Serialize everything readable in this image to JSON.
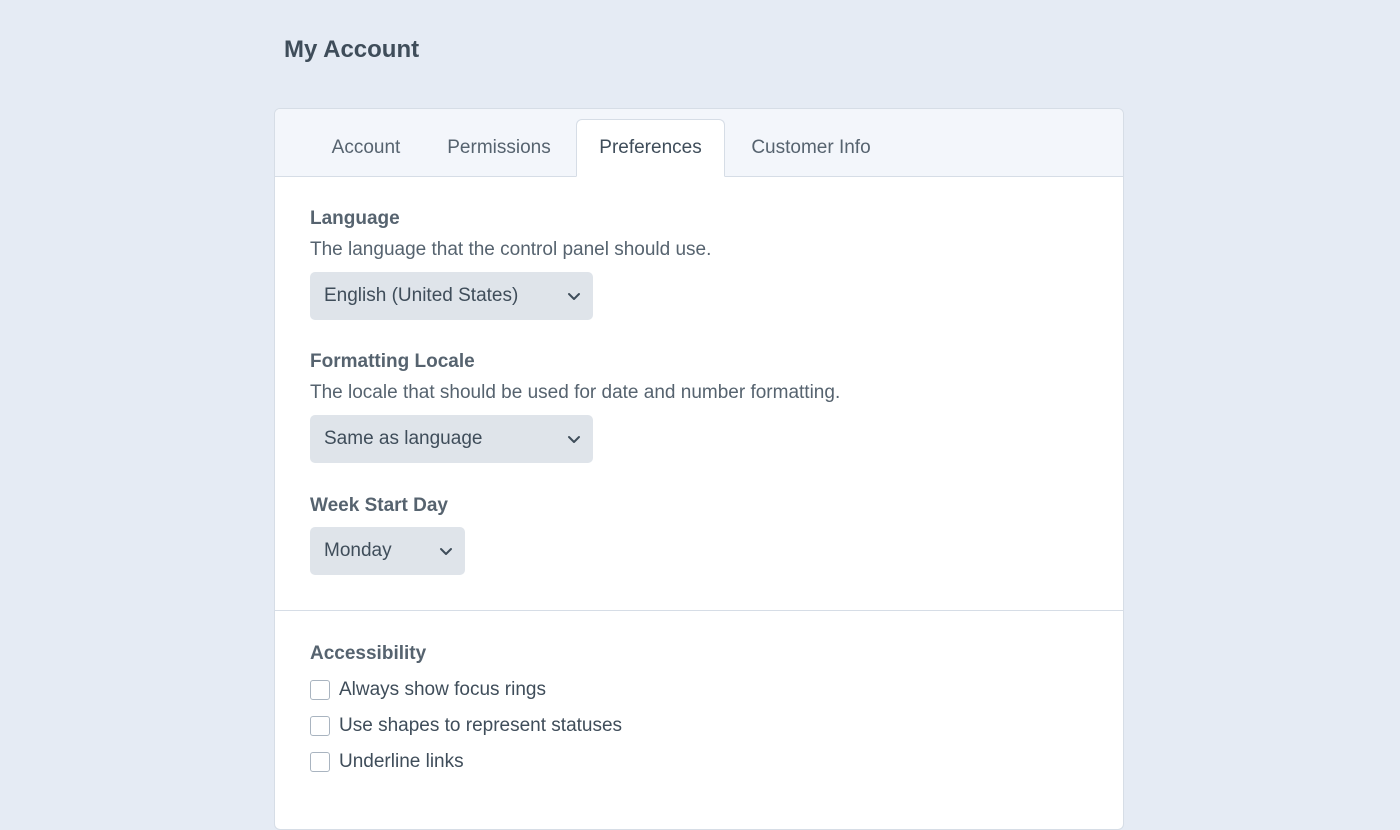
{
  "page": {
    "title": "My Account"
  },
  "tabs": [
    {
      "label": "Account"
    },
    {
      "label": "Permissions"
    },
    {
      "label": "Preferences"
    },
    {
      "label": "Customer Info"
    }
  ],
  "active_tab": "Preferences",
  "fields": {
    "language": {
      "label": "Language",
      "instructions": "The language that the control panel should use.",
      "value": "English (United States)"
    },
    "locale": {
      "label": "Formatting Locale",
      "instructions": "The locale that should be used for date and number formatting.",
      "value": "Same as language"
    },
    "week_start": {
      "label": "Week Start Day",
      "value": "Monday"
    }
  },
  "accessibility": {
    "label": "Accessibility",
    "options": [
      {
        "label": "Always show focus rings",
        "checked": false
      },
      {
        "label": "Use shapes to represent statuses",
        "checked": false
      },
      {
        "label": "Underline links",
        "checked": false
      }
    ]
  },
  "icons": {
    "select_arrow": "chevron-down-icon"
  },
  "colors": {
    "background": "#e5ebf4",
    "card": "#ffffff",
    "tabbar": "#f3f6fb",
    "select": "#dfe4ea"
  }
}
